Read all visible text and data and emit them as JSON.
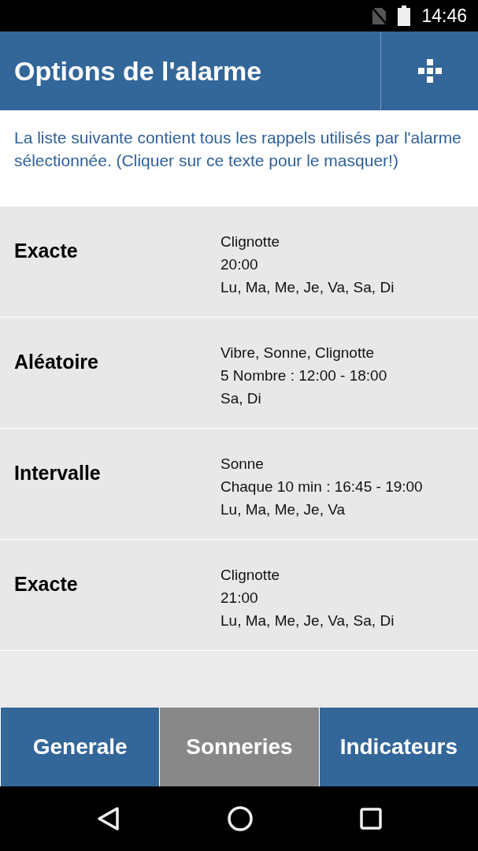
{
  "status_bar": {
    "time": "14:46"
  },
  "header": {
    "title": "Options de l'alarme"
  },
  "info_text": "La liste suivante contient tous les rappels utilisés par l'alarme sélectionnée. (Cliquer sur ce texte pour le masquer!)",
  "reminders": [
    {
      "type": "Exacte",
      "lines": [
        "Clignotte",
        "20:00",
        "Lu, Ma, Me, Je, Va, Sa, Di"
      ]
    },
    {
      "type": "Aléatoire",
      "lines": [
        "Vibre, Sonne, Clignotte",
        "5 Nombre : 12:00 - 18:00",
        "Sa, Di"
      ]
    },
    {
      "type": "Intervalle",
      "lines": [
        "Sonne",
        "Chaque 10 min : 16:45 - 19:00",
        "Lu, Ma, Me, Je, Va"
      ]
    },
    {
      "type": "Exacte",
      "lines": [
        "Clignotte",
        "21:00",
        "Lu, Ma, Me, Je, Va, Sa, Di"
      ]
    }
  ],
  "tabs": [
    {
      "label": "Generale",
      "selected": false
    },
    {
      "label": "Sonneries",
      "selected": true
    },
    {
      "label": "Indicateurs",
      "selected": false
    }
  ]
}
